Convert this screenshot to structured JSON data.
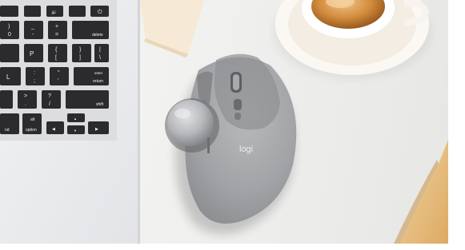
{
  "scene": {
    "description_label": "",
    "brand_on_mouse": "logi",
    "colors": {
      "desk": "#f2f2f0",
      "laptop_body": "#e9eaec",
      "keycap": "#2b2b2d",
      "mouse_body": "#a7a8aa",
      "mouse_dark": "#6f7073",
      "trackball": "#b9babc",
      "saucer": "#f7f3ee",
      "coffee": "#c07a2e",
      "wood": "#e8c48a",
      "notebook": "#f3e7d3"
    }
  },
  "keyboard": {
    "row_top": [
      "🔉",
      "🔊",
      "🔈",
      "⏻"
    ],
    "row2": [
      ")",
      "_",
      "+",
      "delete"
    ],
    "row2_sub": [
      "0",
      "-",
      "=",
      ""
    ],
    "row3": [
      "P",
      "{",
      "}",
      "|"
    ],
    "row3_sub": [
      "",
      "[",
      "]",
      "\\"
    ],
    "row4": [
      "L",
      ":",
      "\"",
      "enter"
    ],
    "row4_sub": [
      "",
      ";",
      "'",
      "return"
    ],
    "row5": [
      ">",
      "?",
      "shift"
    ],
    "row5_sub": [
      ".",
      "/",
      ""
    ],
    "row6": [
      "nd",
      "alt",
      "option",
      "◀",
      "▲",
      "▼",
      "▶"
    ]
  }
}
